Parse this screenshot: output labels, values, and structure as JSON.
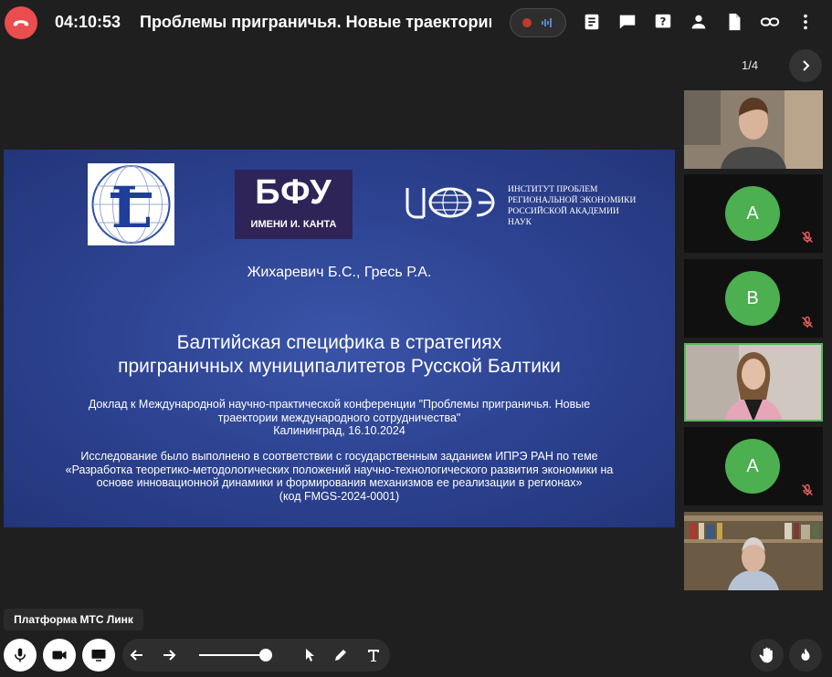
{
  "header": {
    "timer": "04:10:53",
    "title": "Проблемы приграничья. Новые траектории м"
  },
  "pager": {
    "label": "1/4"
  },
  "slide": {
    "logo_main": "БФУ",
    "logo_sub": "ИМЕНИ И. КАНТА",
    "institute_lines": [
      "ИНСТИТУТ ПРОБЛЕМ",
      "РЕГИОНАЛЬНОЙ ЭКОНОМИКИ",
      "РОССИЙСКОЙ АКАДЕМИИ",
      "НАУК"
    ],
    "authors": "Жихаревич Б.С., Гресь Р.А.",
    "title_lines": [
      "Балтийская специфика в стратегиях",
      "приграничных муниципалитетов Русской Балтики"
    ],
    "report_lines": [
      "Доклад к Международной научно-практической конференции \"Проблемы приграничья. Новые",
      "траектории международного сотрудничества\"",
      "Калининград, 16.10.2024"
    ],
    "research_lines": [
      "Исследование было выполнено в соответствии с государственным заданием ИПРЭ РАН по теме",
      "«Разработка теоретико-методологических положений научно-технологического развития экономики на",
      "основе инновационной динамики и формирования механизмов ее реализации в регионах»",
      "(код FMGS-2024-0001)"
    ]
  },
  "participants": [
    {
      "type": "video",
      "tone": "young-man"
    },
    {
      "type": "avatar",
      "initial": "A",
      "muted": true
    },
    {
      "type": "avatar",
      "initial": "B",
      "muted": true
    },
    {
      "type": "video",
      "tone": "young-woman",
      "active": true
    },
    {
      "type": "avatar",
      "initial": "A",
      "muted": true
    },
    {
      "type": "video",
      "tone": "older-man"
    }
  ],
  "tooltip": {
    "label": "Платформа МТС Линк"
  },
  "colors": {
    "accent_green": "#4caf50",
    "end_call": "#ea4d4d",
    "slide_blue": "#2c418f",
    "mute_red": "#e35b5b"
  }
}
